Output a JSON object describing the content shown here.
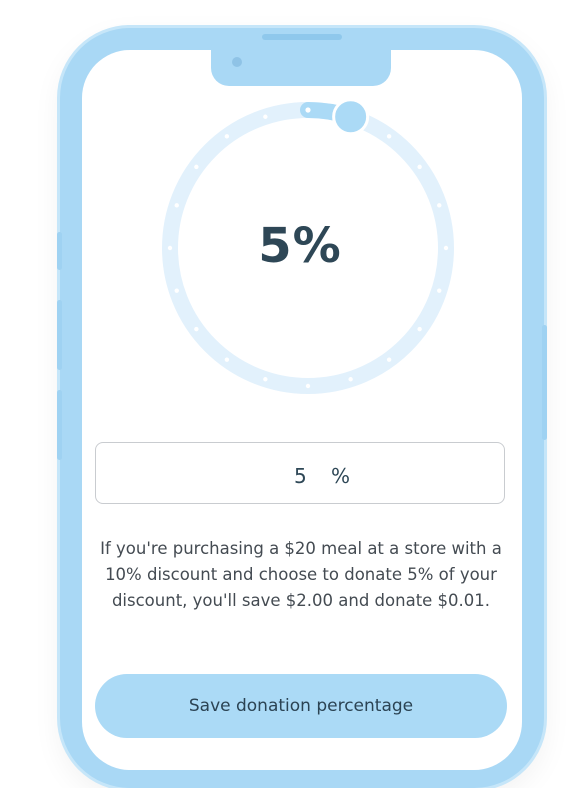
{
  "donation": {
    "percentage": 5,
    "display": "5%",
    "input_value": "5",
    "unit": "%",
    "description": "If you're purchasing a $20 meal at a store with a 10% discount and choose to donate 5% of your discount, you'll save $2.00 and donate $0.01.",
    "save_label": "Save donation percentage",
    "slider_fraction": 0.05
  },
  "colors": {
    "accent": "#abdaf6",
    "track": "#e2f1fc",
    "text_dark": "#2e4756",
    "phone_frame": "#a9d8f5"
  }
}
